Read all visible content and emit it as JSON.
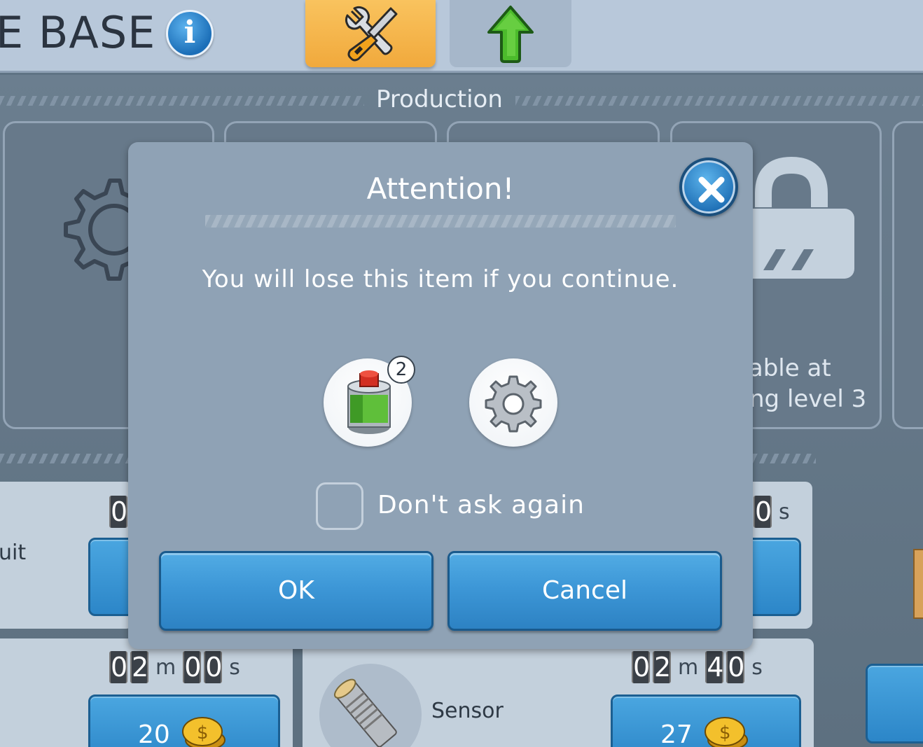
{
  "header": {
    "title": "E BASE",
    "info_icon": "i",
    "tabs": [
      {
        "name": "tools-tab",
        "icon": "wrench-screwdriver-icon",
        "active": true
      },
      {
        "name": "upgrade-tab",
        "icon": "green-up-arrow-icon",
        "active": false
      }
    ]
  },
  "background": {
    "section_title": "Production",
    "locked_slot_text_line1": "ilable at",
    "locked_slot_text_line2": "ng level 3",
    "rows": [
      {
        "label": "uit",
        "timer_digits": [
          "0"
        ],
        "timer_unit_s": "s"
      },
      {
        "timer_digits_right": [
          "0"
        ],
        "unit_s": "s"
      },
      {
        "timer_min": [
          "0",
          "2"
        ],
        "unit_m": "m",
        "timer_sec": [
          "0",
          "0"
        ],
        "unit_s": "s",
        "price": "20"
      },
      {
        "label": "Sensor",
        "timer_min": [
          "0",
          "2"
        ],
        "unit_m": "m",
        "timer_sec": [
          "4",
          "0"
        ],
        "unit_s": "s",
        "price": "27"
      }
    ]
  },
  "dialog": {
    "title": "Attention!",
    "message": "You will lose this item if you continue.",
    "items": [
      {
        "icon": "paint-can-icon",
        "count": "2"
      },
      {
        "icon": "gear-icon"
      }
    ],
    "checkbox_label": "Don't ask again",
    "checkbox_checked": false,
    "ok_label": "OK",
    "cancel_label": "Cancel"
  },
  "colors": {
    "accent_blue": "#3d97d7",
    "tab_active": "#f5b54a",
    "dialog_bg": "#8fa2b5"
  }
}
